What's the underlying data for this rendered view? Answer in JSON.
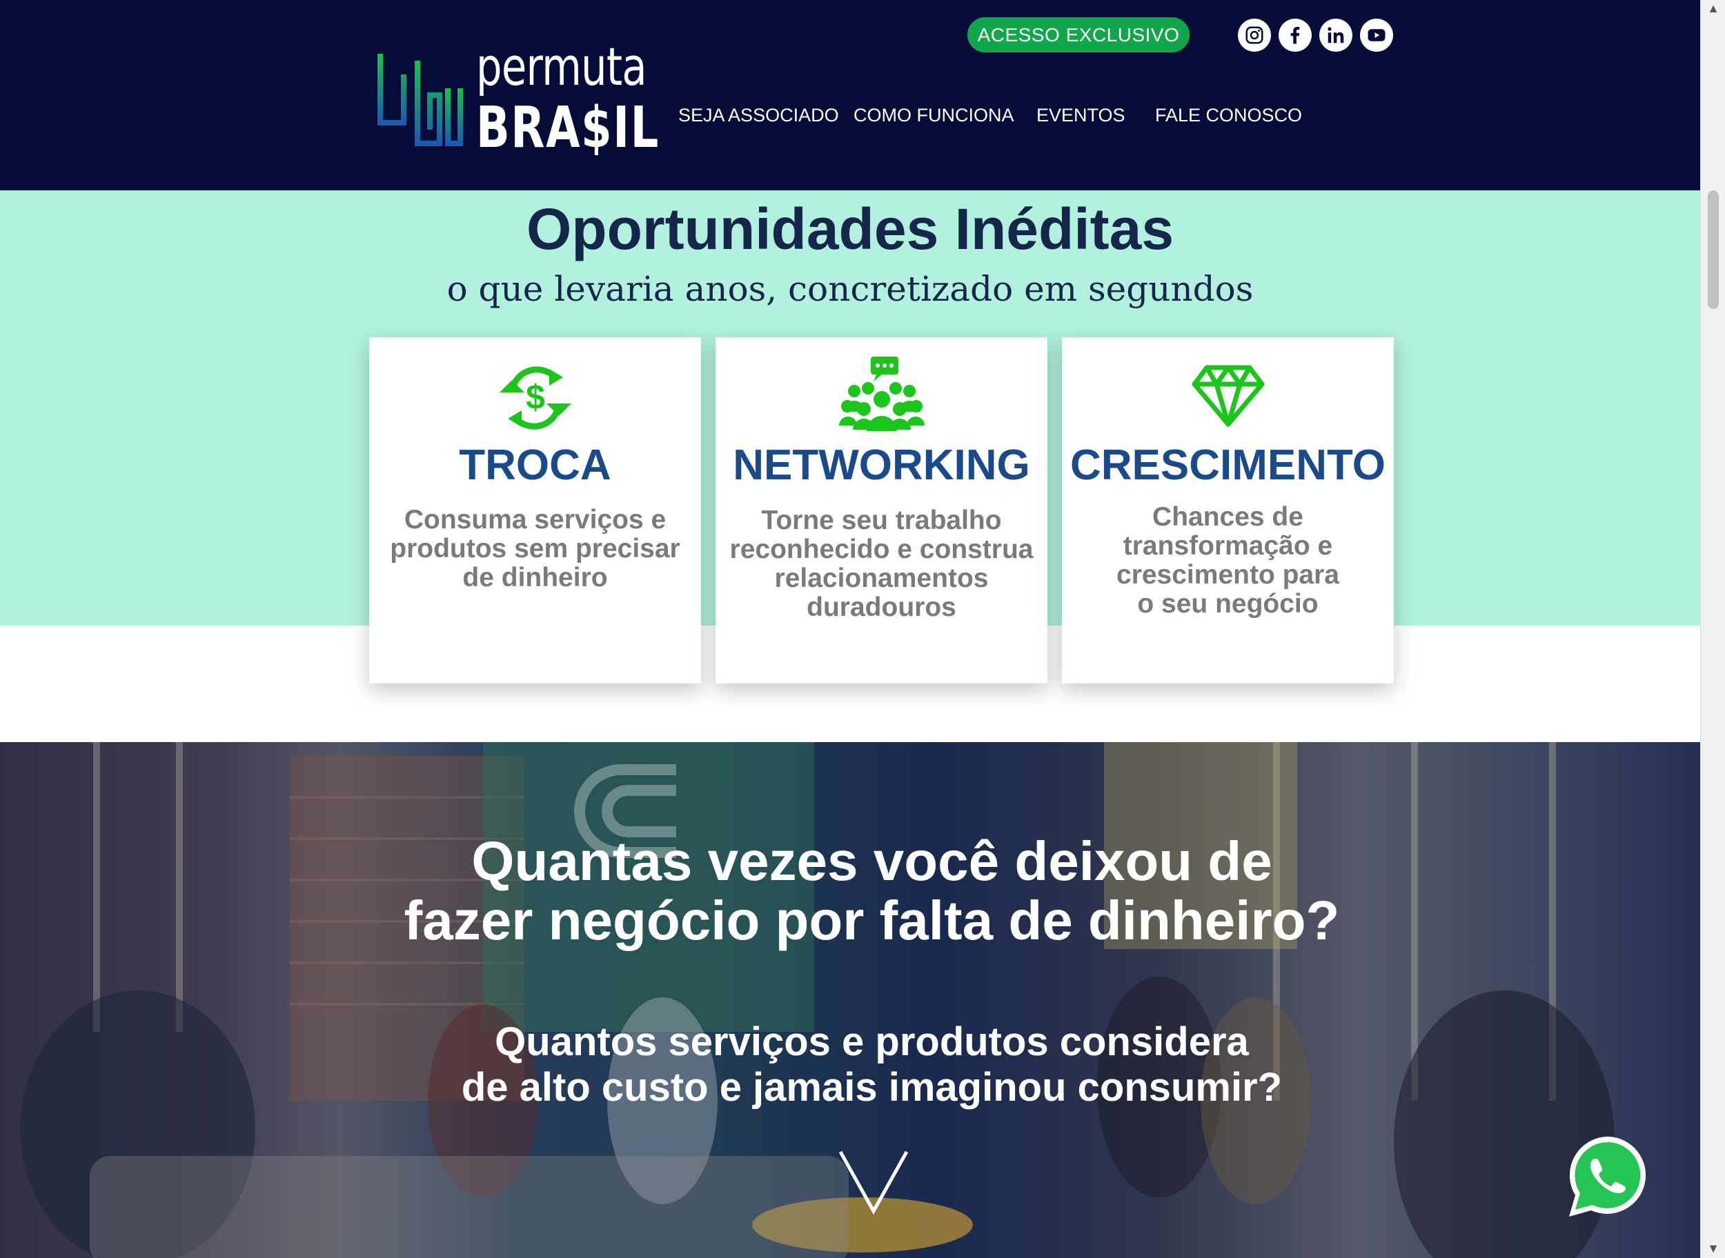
{
  "header": {
    "logo": {
      "line1": "permuta",
      "line2": "BRA$IL"
    },
    "cta_label": "ACESSO EXCLUSIVO",
    "social": [
      "instagram-icon",
      "facebook-icon",
      "linkedin-icon",
      "youtube-icon"
    ],
    "nav": [
      "SEJA ASSOCIADO",
      "COMO FUNCIONA",
      "EVENTOS",
      "FALE CONOSCO"
    ]
  },
  "opportunities": {
    "title": "Oportunidades Inéditas",
    "subtitle": "o que levaria anos, concretizado em segundos",
    "cards": [
      {
        "icon": "money-exchange-icon",
        "title": "TROCA",
        "text": [
          "Consuma serviços e",
          "produtos sem precisar",
          "de dinheiro"
        ]
      },
      {
        "icon": "people-chat-icon",
        "title": "NETWORKING",
        "text": [
          "Torne seu trabalho",
          "reconhecido e construa",
          "relacionamentos",
          "duradouros"
        ]
      },
      {
        "icon": "diamond-icon",
        "title": "CRESCIMENTO",
        "text": [
          "Chances de",
          "transformação e",
          "crescimento para",
          "o seu negócio"
        ]
      }
    ]
  },
  "hero": {
    "question1": [
      "Quantas vezes você deixou de",
      "fazer negócio por falta de dinheiro?"
    ],
    "question2": [
      "Quantos serviços e produtos considera",
      "de alto custo e jamais imaginou consumir?"
    ],
    "scroll_icon": "chevron-down-icon"
  },
  "floating": {
    "whatsapp_icon": "whatsapp-icon"
  },
  "colors": {
    "header_bg": "#050c38",
    "cta_green": "#12a64a",
    "mint": "#b1f1de",
    "card_title_blue": "#1b4a8a",
    "icon_green": "#1cc41c",
    "title_navy": "#15264a"
  }
}
